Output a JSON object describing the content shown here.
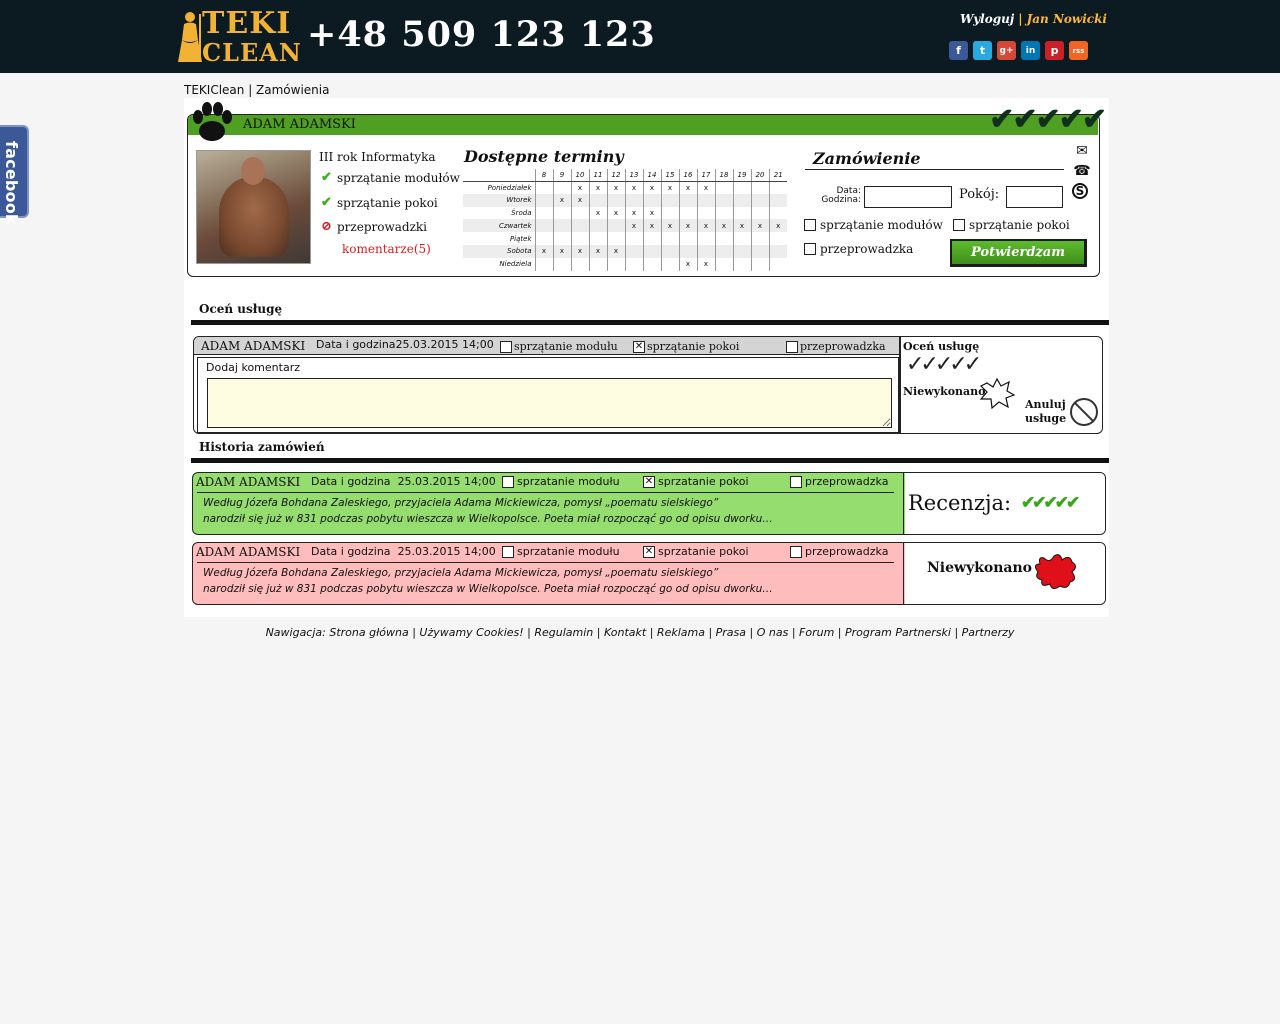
{
  "header": {
    "logo_line1": "TEKI",
    "logo_line2": "CLEAN",
    "phone": "+48 509 123 123",
    "logout_label": "Wyloguj",
    "separator": "|",
    "user_name": "Jan Nowicki",
    "socials": [
      {
        "icon": "facebook-icon",
        "glyph": "f",
        "color": "#3b5998"
      },
      {
        "icon": "twitter-icon",
        "glyph": "t",
        "color": "#29a9e1"
      },
      {
        "icon": "google-plus-icon",
        "glyph": "g+",
        "color": "#d34836"
      },
      {
        "icon": "linkedin-icon",
        "glyph": "in",
        "color": "#0077b5"
      },
      {
        "icon": "pinterest-icon",
        "glyph": "p",
        "color": "#cb2027"
      },
      {
        "icon": "rss-icon",
        "glyph": "rss",
        "color": "#f26522"
      }
    ]
  },
  "facebook_tab": "facebook",
  "breadcrumb": "TEKIClean | Zamówienia",
  "profile": {
    "name": "ADAM ADAMSKI",
    "subtitle": "III rok Informatyka",
    "services": [
      {
        "label": "sprzątanie modułów",
        "mark": "✔",
        "mark_color": "#3cb01a"
      },
      {
        "label": "sprzątanie pokoi",
        "mark": "✔",
        "mark_color": "#3cb01a"
      },
      {
        "label": "przeprowadzki",
        "mark": "⊘",
        "mark_color": "#d81e1e"
      }
    ],
    "comments_link": "komentarze(5)"
  },
  "schedule": {
    "title": "Dostępne terminy",
    "hours": [
      "8",
      "9",
      "10",
      "11",
      "12",
      "13",
      "14",
      "15",
      "16",
      "17",
      "18",
      "19",
      "20",
      "21"
    ],
    "days": [
      {
        "day": "Poniedziałek",
        "cells": [
          "",
          "",
          "x",
          "x",
          "x",
          "x",
          "x",
          "x",
          "x",
          "x",
          "",
          "",
          "",
          ""
        ]
      },
      {
        "day": "Wtorek",
        "cells": [
          "",
          "x",
          "x",
          "",
          "",
          "",
          "",
          "",
          "",
          "",
          "",
          "",
          "",
          ""
        ]
      },
      {
        "day": "Środa",
        "cells": [
          "",
          "",
          "",
          "x",
          "x",
          "x",
          "x",
          "",
          "",
          "",
          "",
          "",
          "",
          ""
        ]
      },
      {
        "day": "Czwartek",
        "cells": [
          "",
          "",
          "",
          "",
          "",
          "x",
          "x",
          "x",
          "x",
          "x",
          "x",
          "x",
          "x",
          "x"
        ]
      },
      {
        "day": "Piątek",
        "cells": [
          "",
          "",
          "",
          "",
          "",
          "",
          "",
          "",
          "",
          "",
          "",
          "",
          "",
          ""
        ]
      },
      {
        "day": "Sobota",
        "cells": [
          "x",
          "x",
          "x",
          "x",
          "x",
          "",
          "",
          "",
          "",
          "",
          "",
          "",
          "",
          ""
        ]
      },
      {
        "day": "Niedziela",
        "cells": [
          "",
          "",
          "",
          "",
          "",
          "",
          "",
          "",
          "x",
          "x",
          "",
          "",
          "",
          ""
        ]
      }
    ]
  },
  "order": {
    "title": "Zamówienie",
    "date_label_1": "Data:",
    "date_label_2": "Godzina:",
    "date_value": "",
    "room_label": "Pokój:",
    "room_value": "",
    "options": [
      "sprzątanie modułów",
      "sprzątanie pokoi",
      "przeprowadzka"
    ],
    "confirm_label": "Potwierdzam",
    "contact_icons": [
      "mail-icon",
      "phone-icon",
      "skype-icon"
    ]
  },
  "rate_section": {
    "title": "Oceń usługę",
    "name": "ADAM ADAMSKI",
    "date_label": "Data i godzina",
    "date_value": "25.03.2015 14;00",
    "options": [
      {
        "label": "sprzątanie modułu",
        "checked": false
      },
      {
        "label": "sprzątanie pokoi",
        "checked": true
      },
      {
        "label": "przeprowadzka",
        "checked": false
      }
    ],
    "add_comment_label": "Dodaj komentarz",
    "comment_value": "",
    "rate_label": "Oceń usługę",
    "not_done_label": "Niewykonano",
    "cancel_label_1": "Anuluj",
    "cancel_label_2": "usługe"
  },
  "history": {
    "title": "Historia zamówień",
    "entries": [
      {
        "name": "ADAM ADAMSKI",
        "date_label": "Data i godzina",
        "date_value": "25.03.2015 14;00",
        "options": [
          "sprzatanie modułu",
          "sprzatanie pokoi",
          "przeprowadzka"
        ],
        "line1": "Według Józefa Bohdana Zaleskiego, przyjaciela Adama Mickiewicza, pomysł „poematu sielskiego”",
        "line2": "narodził się już w  831 podczas pobytu wieszcza w Wielkopolsce. Poeta miał rozpocząć go od opisu dworku…",
        "status_label": "Recenzja:",
        "background": "#95dd6f"
      },
      {
        "name": "ADAM ADAMSKI",
        "date_label": "Data i godzina",
        "date_value": "25.03.2015 14;00",
        "options": [
          "sprzatanie modułu",
          "sprzatanie pokoi",
          "przeprowadzka"
        ],
        "line1": "Według Józefa Bohdana Zaleskiego, przyjaciela Adama Mickiewicza, pomysł „poematu sielskiego”",
        "line2": "narodził się już w  831 podczas pobytu wieszcza w Wielkopolsce. Poeta miał rozpocząć go od opisu dworku…",
        "status_label": "Niewykonano",
        "background": "#ffbcbc"
      }
    ]
  },
  "footer": "Nawigacja: Strona główna | Używamy Cookies! | Regulamin | Kontakt | Reklama | Prasa | O nas | Forum | Program Partnerski | Partnerzy"
}
